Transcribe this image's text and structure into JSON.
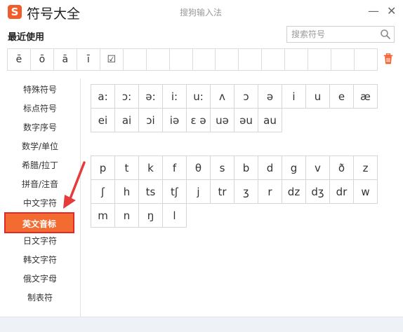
{
  "window": {
    "logo_letter": "S",
    "app_title": "符号大全",
    "caption": "搜狗输入法",
    "minimize_glyph": "—",
    "close_glyph": "✕"
  },
  "recent": {
    "label": "最近使用",
    "items": [
      "ē",
      "ō",
      "ā",
      "ī",
      "☑",
      "",
      "",
      "",
      "",
      "",
      "",
      "",
      "",
      "",
      "",
      ""
    ],
    "trash_icon": "trash-icon"
  },
  "search": {
    "placeholder": "搜索符号",
    "value": ""
  },
  "categories": {
    "items": [
      "特殊符号",
      "标点符号",
      "数字序号",
      "数学/单位",
      "希腊/拉丁",
      "拼音/注音",
      "中文字符",
      "英文音标",
      "日文字符",
      "韩文字符",
      "俄文字母",
      "制表符"
    ],
    "selected": "英文音标"
  },
  "vowels": [
    [
      "a:",
      "ɔ:",
      "ə:",
      "i:",
      "u:",
      "ʌ",
      "ɔ",
      "ə",
      "i",
      "u",
      "e",
      "æ"
    ],
    [
      "ei",
      "ai",
      "ɔi",
      "iə",
      "ɛ ə",
      "uə",
      "əu",
      "au"
    ]
  ],
  "consonants": [
    [
      "p",
      "t",
      "k",
      "f",
      "θ",
      "s",
      "b",
      "d",
      "g",
      "v",
      "ð",
      "z"
    ],
    [
      "ʃ",
      "h",
      "ts",
      "tʃ",
      "j",
      "tr",
      "ʒ",
      "r",
      "dz",
      "dʒ",
      "dr",
      "w"
    ],
    [
      "m",
      "n",
      "ŋ",
      "l"
    ]
  ],
  "colors": {
    "accent": "#f36b30",
    "highlight_border": "#e02a2a",
    "arrow": "#e63b3b"
  }
}
